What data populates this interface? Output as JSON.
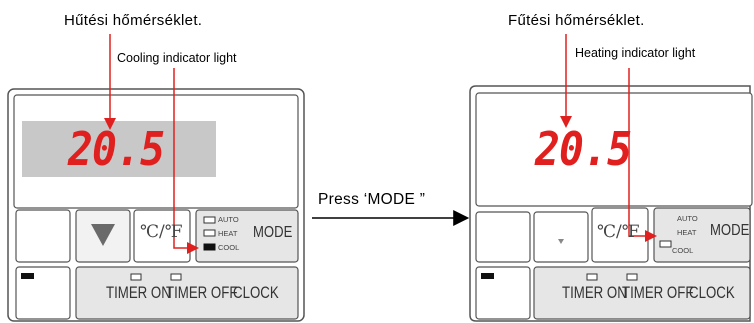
{
  "left": {
    "title": "Hűtési hőmérséklet.",
    "indicator_caption": "Cooling indicator light",
    "display_value": "20.5",
    "indicators": [
      "AUTO",
      "HEAT",
      "COOL"
    ],
    "active_indicator": "COOL",
    "mode_label": "MODE",
    "unit_label": "℃/℉",
    "bottom_labels": [
      "TIMER ON",
      "TIMER OFF",
      "CLOCK"
    ]
  },
  "right": {
    "title": "Fűtési hőmérséklet.",
    "indicator_caption": "Heating indicator light",
    "display_value": "20.5",
    "indicators": [
      "AUTO",
      "HEAT",
      "COOL"
    ],
    "active_indicator": "HEAT",
    "mode_label": "MODE",
    "unit_label": "℃/℉",
    "bottom_labels": [
      "TIMER ON",
      "TIMER OFF",
      "CLOCK"
    ]
  },
  "transition": {
    "label": "Press ‘MODE ”"
  },
  "colors": {
    "digits": "#e0201e",
    "arrow": "#e0201e",
    "lcd_left": "#c8c8c8",
    "panel": "#e6e6e6"
  }
}
